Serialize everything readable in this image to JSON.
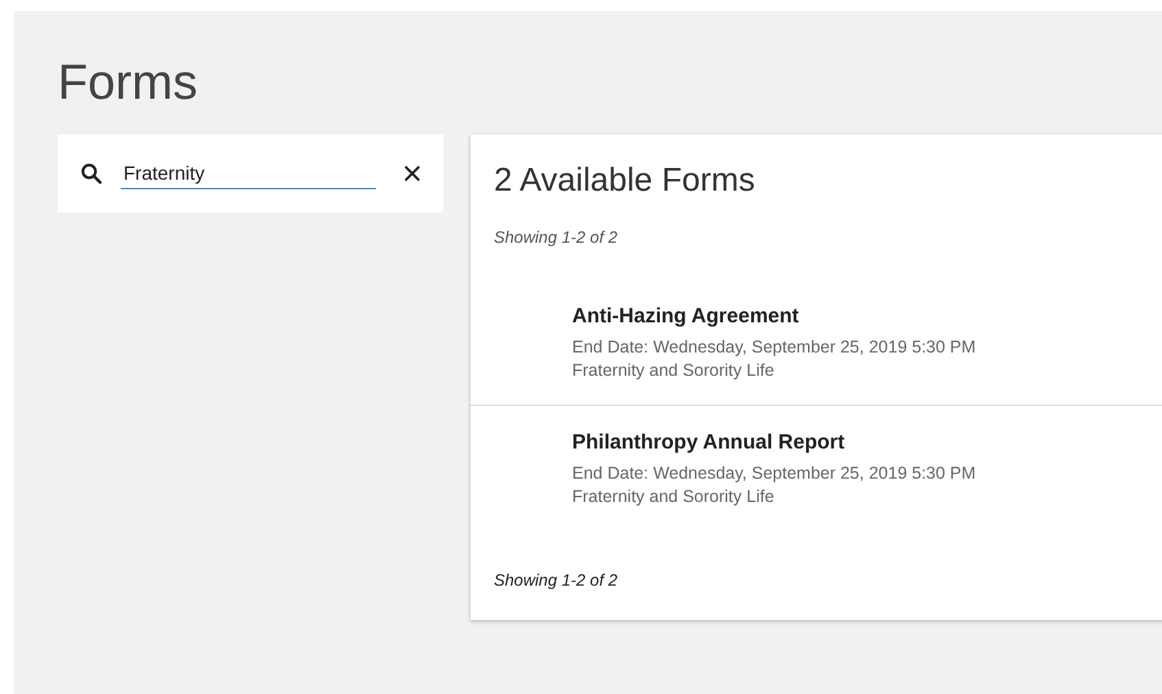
{
  "page_title": "Forms",
  "search": {
    "value": "Fraternity"
  },
  "results": {
    "heading": "2 Available Forms",
    "summary_top": "Showing 1-2 of 2",
    "forms": [
      {
        "title": "Anti-Hazing Agreement",
        "end_date": "End Date: Wednesday, September 25, 2019 5:30 PM",
        "organization": "Fraternity and Sorority Life"
      },
      {
        "title": "Philanthropy Annual Report",
        "end_date": "End Date: Wednesday, September 25, 2019 5:30 PM",
        "organization": "Fraternity and Sorority Life"
      }
    ],
    "summary_bottom": "Showing 1-2 of 2"
  }
}
